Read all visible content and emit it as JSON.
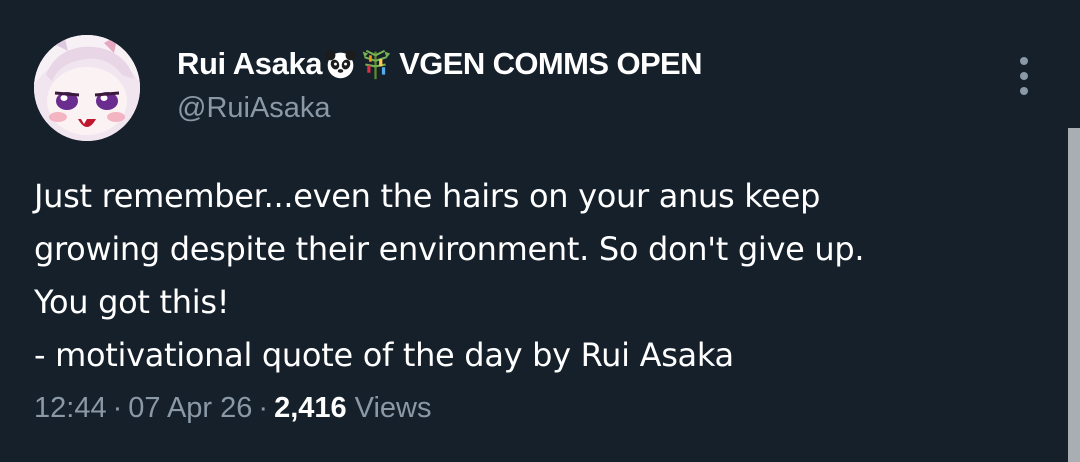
{
  "author": {
    "display_name": "Rui Asaka",
    "emoji_icons": [
      "panda-icon",
      "tanabata-tree-icon"
    ],
    "name_suffix": "VGEN COMMS OPEN",
    "handle": "@RuiAsaka"
  },
  "tweet": {
    "lines": [
      "Just remember...even the hairs on your anus keep",
      "growing despite their environment. So don't give up.",
      "You got this!",
      "- motivational quote of the day by Rui Asaka"
    ]
  },
  "meta": {
    "time": "12:44",
    "separator": "·",
    "date": "07 Apr 26",
    "views_count": "2,416",
    "views_label": "Views"
  },
  "colors": {
    "background": "#15202b",
    "primary_text": "#ffffff",
    "secondary_text": "#8b98a5"
  }
}
